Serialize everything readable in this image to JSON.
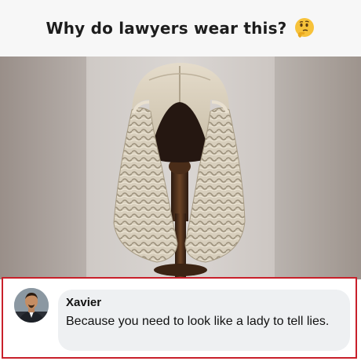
{
  "post": {
    "title": "Why do lawyers wear this?",
    "title_emoji": "thinking-face-icon",
    "image_subject": "barrister-wig-on-wooden-stand"
  },
  "comment": {
    "author": "Xavier",
    "text": "Because you need to look like a lady to tell lies.",
    "avatar": "avatar"
  },
  "colors": {
    "header_bg": "#f7f7f7",
    "frame_border": "#c8202a",
    "bubble_bg": "#eef0f2",
    "text": "#111111"
  }
}
